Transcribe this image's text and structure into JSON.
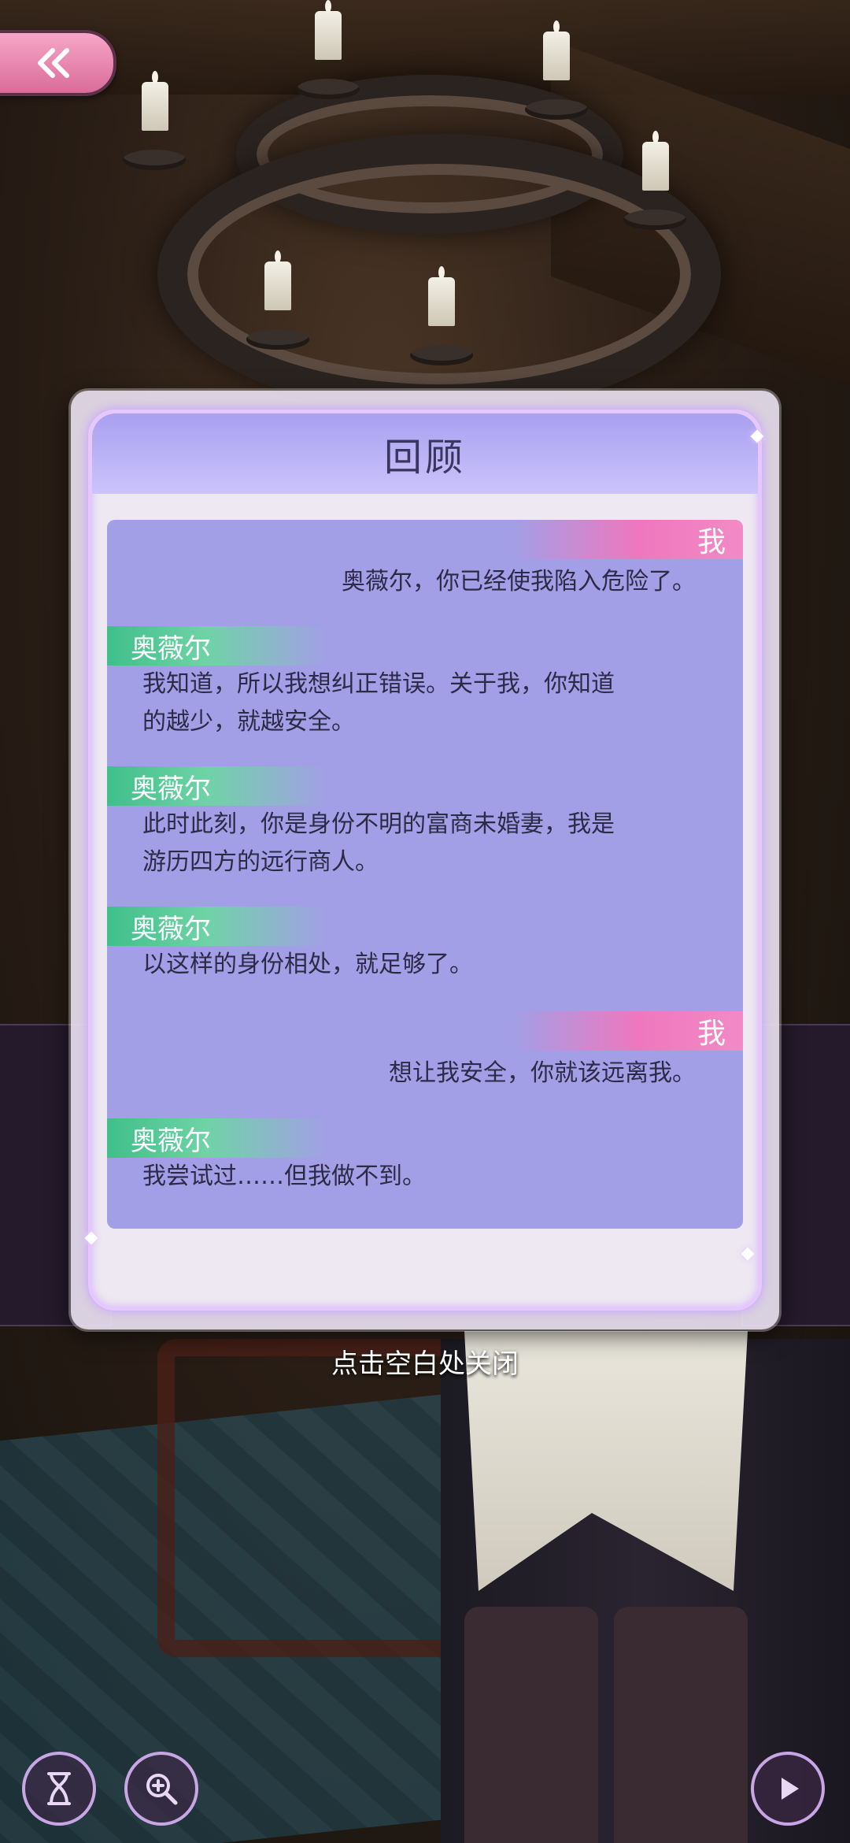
{
  "dialog": {
    "title": "回顾",
    "entries": [
      {
        "speaker": "我",
        "side": "right",
        "lines": [
          "奥薇尔，你已经使我陷入危险了。"
        ]
      },
      {
        "speaker": "奥薇尔",
        "side": "left",
        "lines": [
          "我知道，所以我想纠正错误。关于我，你知道",
          "的越少，就越安全。"
        ]
      },
      {
        "speaker": "奥薇尔",
        "side": "left",
        "lines": [
          "此时此刻，你是身份不明的富商未婚妻，我是",
          "游历四方的远行商人。"
        ]
      },
      {
        "speaker": "奥薇尔",
        "side": "left",
        "lines": [
          "以这样的身份相处，就足够了。"
        ]
      },
      {
        "speaker": "我",
        "side": "right",
        "lines": [
          "想让我安全，你就该远离我。"
        ]
      },
      {
        "speaker": "奥薇尔",
        "side": "left",
        "lines": [
          "我尝试过……但我做不到。"
        ]
      }
    ]
  },
  "close_hint": "点击空白处关闭",
  "icons": {
    "back": "double-chevron-left-icon",
    "hourglass": "hourglass-icon",
    "zoom": "zoom-in-icon",
    "play": "play-icon"
  },
  "colors": {
    "title_band": "#a9a0f0",
    "log_background": "#a39fe6",
    "player_tag": "#ef77bd",
    "npc_tag": "#3fbf8a",
    "back_button": "#e886b0"
  }
}
